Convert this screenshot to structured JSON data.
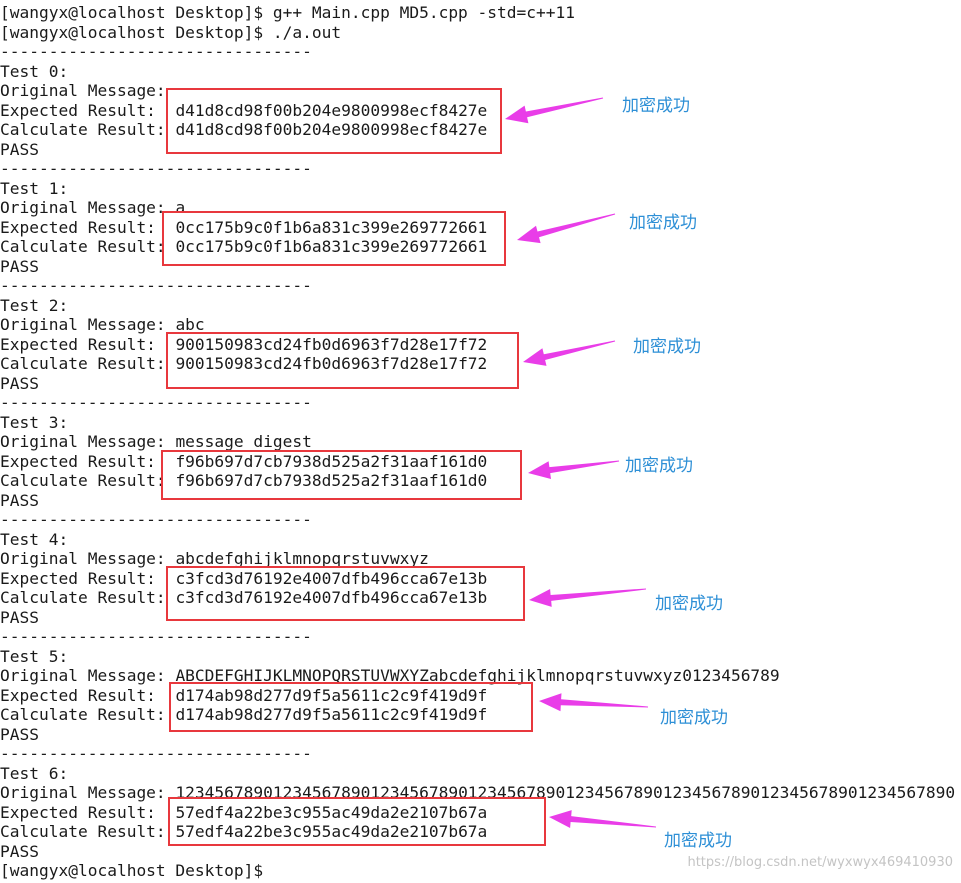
{
  "prompt_user": "[wangyx@localhost Desktop]$",
  "commands": [
    "g++ Main.cpp MD5.cpp -std=c++11",
    "./a.out"
  ],
  "separator": "--------------------------------",
  "labels": {
    "original": "Original Message:",
    "expected": "Expected Result:",
    "calculate": "Calculate Result:",
    "pass": "PASS"
  },
  "tests": [
    {
      "title": "Test 0:",
      "message": "",
      "expected": "d41d8cd98f00b204e9800998ecf8427e",
      "calculated": "d41d8cd98f00b204e9800998ecf8427e"
    },
    {
      "title": "Test 1:",
      "message": "a",
      "expected": "0cc175b9c0f1b6a831c399e269772661",
      "calculated": "0cc175b9c0f1b6a831c399e269772661"
    },
    {
      "title": "Test 2:",
      "message": "abc",
      "expected": "900150983cd24fb0d6963f7d28e17f72",
      "calculated": "900150983cd24fb0d6963f7d28e17f72"
    },
    {
      "title": "Test 3:",
      "message": "message digest",
      "expected": "f96b697d7cb7938d525a2f31aaf161d0",
      "calculated": "f96b697d7cb7938d525a2f31aaf161d0"
    },
    {
      "title": "Test 4:",
      "message": "abcdefghijklmnopqrstuvwxyz",
      "expected": "c3fcd3d76192e4007dfb496cca67e13b",
      "calculated": "c3fcd3d76192e4007dfb496cca67e13b"
    },
    {
      "title": "Test 5:",
      "message": "ABCDEFGHIJKLMNOPQRSTUVWXYZabcdefghijklmnopqrstuvwxyz0123456789",
      "expected": "d174ab98d277d9f5a5611c2c9f419d9f",
      "calculated": "d174ab98d277d9f5a5611c2c9f419d9f"
    },
    {
      "title": "Test 6:",
      "message": "12345678901234567890123456789012345678901234567890123456789012345678901234567890",
      "expected": "57edf4a22be3c955ac49da2e2107b67a",
      "calculated": "57edf4a22be3c955ac49da2e2107b67a"
    }
  ],
  "annotation_text": "加密成功",
  "annotation_color": "#2d8fd6",
  "arrow_color": "#e93de8",
  "box_color": "#e8383d",
  "watermark": "https://blog.csdn.net/wyxwyx469410930"
}
